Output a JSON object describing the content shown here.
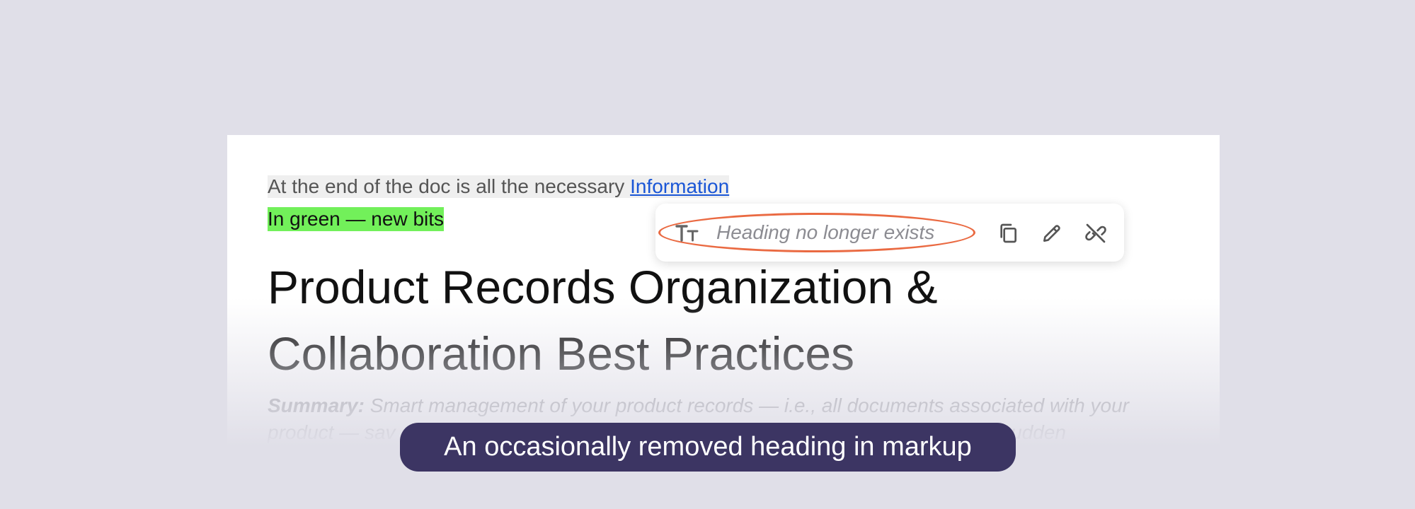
{
  "document": {
    "intro_text": "At the end of the doc is all the necessary ",
    "intro_link": "Information",
    "green_note": "In green — new bits",
    "title_line1": "Product Records Organization &",
    "title_line2": "Collaboration Best Practices",
    "summary_label": "Summary:",
    "summary_line1": " Smart management of your product records — i.e., all documents associated with your",
    "summary_line2": "product — sav",
    "summary_line2_end": "tion or sudden"
  },
  "link_popover": {
    "status_text": "Heading no longer exists",
    "icons": [
      "text-format-icon",
      "copy-icon",
      "edit-icon",
      "unlink-icon"
    ],
    "highlight_color": "#ea6a42"
  },
  "caption": {
    "text": "An occasionally removed heading in markup"
  },
  "colors": {
    "background": "#e0dfe8",
    "link": "#1a56d6",
    "green_highlight": "#72f05a",
    "caption_bg": "#3c3563"
  }
}
